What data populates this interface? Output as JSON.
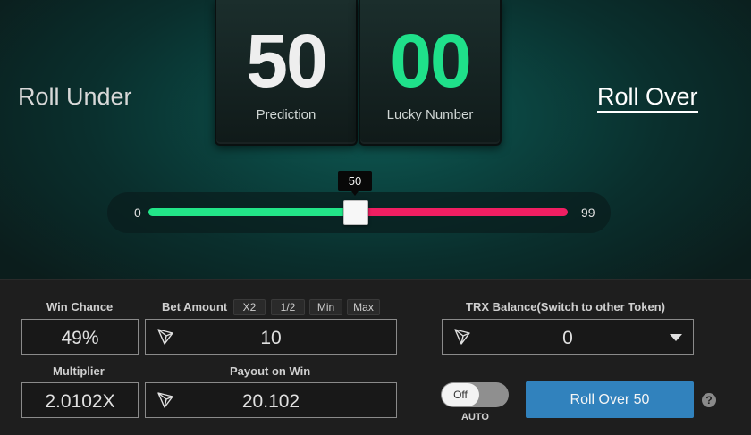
{
  "game": {
    "prediction_value": "50",
    "prediction_label": "Prediction",
    "lucky_value": "00",
    "lucky_label": "Lucky Number",
    "roll_under_label": "Roll Under",
    "roll_over_label": "Roll Over"
  },
  "slider": {
    "min_label": "0",
    "max_label": "99",
    "value": 50,
    "tooltip": "50"
  },
  "colors": {
    "under_color": "#22e588",
    "over_color": "#ef1f62",
    "lucky_color": "#1fe08a",
    "button_color": "#3182bd"
  },
  "controls": {
    "win_chance_label": "Win Chance",
    "win_chance_value": "49%",
    "bet_amount_label": "Bet Amount",
    "bet_amount_value": "10",
    "chip_x2": "X2",
    "chip_half": "1/2",
    "chip_min": "Min",
    "chip_max": "Max",
    "multiplier_label": "Multiplier",
    "multiplier_value": "2.0102X",
    "payout_label": "Payout on Win",
    "payout_value": "20.102",
    "balance_label": "TRX Balance(Switch to other Token)",
    "balance_value": "0",
    "auto_toggle_state": "Off",
    "auto_label": "AUTO",
    "roll_button_label": "Roll Over 50",
    "help_icon": "?",
    "token_icon": "tron-icon"
  }
}
